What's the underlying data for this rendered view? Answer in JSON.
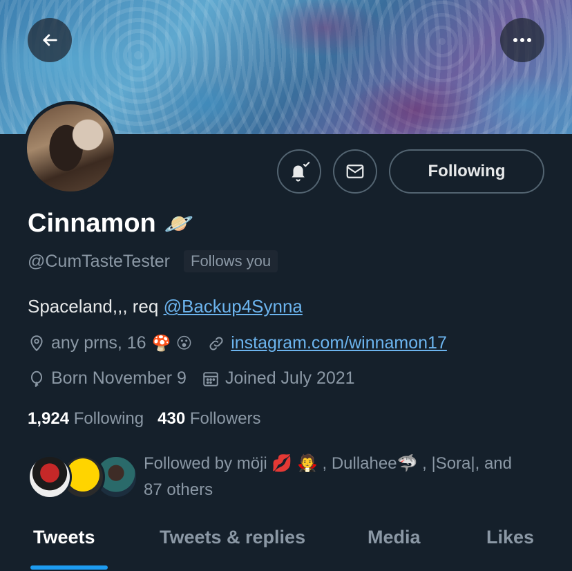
{
  "header": {
    "back_icon": "arrow-left-icon",
    "more_icon": "more-horizontal-icon",
    "banner": "ocean-waves-banner"
  },
  "actions": {
    "notify_icon": "bell-check-icon",
    "message_icon": "envelope-icon",
    "following_label": "Following"
  },
  "profile": {
    "name": "Cinnamon",
    "name_emoji": "🪐",
    "handle": "@CumTasteTester",
    "follows_you": "Follows you",
    "bio_prefix": "Spaceland,,, req ",
    "bio_mention": "@Backup4Synna",
    "location": "any prns, 16",
    "location_emojis": "🍄 😮",
    "website": "instagram.com/winnamon17",
    "birthday": "Born November 9",
    "joined": "Joined July 2021"
  },
  "stats": {
    "following_count": "1,924",
    "following_label": "Following",
    "followers_count": "430",
    "followers_label": "Followers"
  },
  "followed_by": {
    "text_line1": "Followed by möji 💋 🧛 , Dullahee🦈 , |Sora|, and",
    "text_line2": "87 others"
  },
  "tabs": [
    {
      "label": "Tweets",
      "active": true
    },
    {
      "label": "Tweets & replies",
      "active": false
    },
    {
      "label": "Media",
      "active": false
    },
    {
      "label": "Likes",
      "active": false
    }
  ],
  "colors": {
    "background": "#15202b",
    "accent": "#1d9bf0",
    "link": "#6cb4ee",
    "secondary_text": "#8b98a5"
  }
}
